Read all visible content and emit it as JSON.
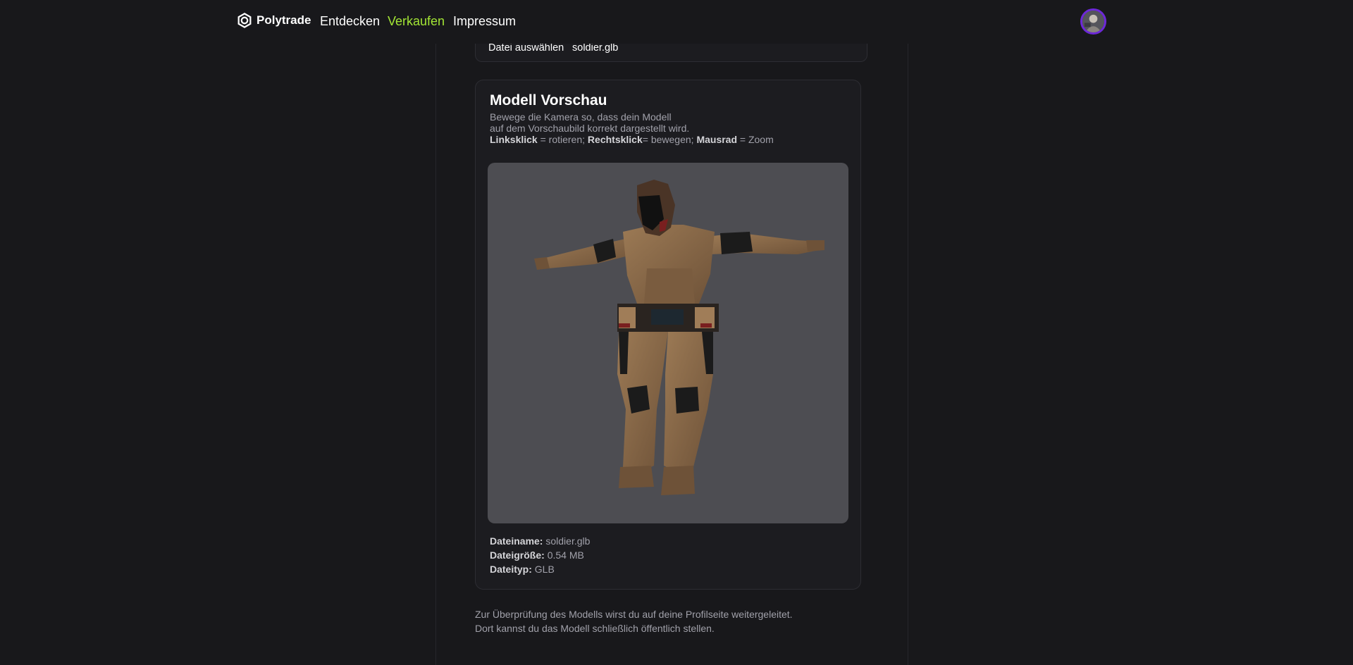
{
  "header": {
    "brand": "Polytrade",
    "nav": [
      {
        "label": "Entdecken"
      },
      {
        "label": "Verkaufen"
      },
      {
        "label": "Impressum"
      }
    ]
  },
  "upload": {
    "button_label": "Datei auswählen",
    "file_name": "soldier.glb"
  },
  "preview": {
    "title": "Modell Vorschau",
    "desc_line1": "Bewege die Kamera so, dass dein Modell",
    "desc_line2": "auf dem Vorschaubild korrekt dargestellt wird.",
    "controls": {
      "left_key": "Linksklick",
      "left_action": "= rotieren;",
      "right_key": "Rechtsklick",
      "right_action": "= bewegen;",
      "wheel_key": "Mausrad",
      "wheel_action": "= Zoom"
    },
    "meta": {
      "name_label": "Dateiname:",
      "name_value": "soldier.glb",
      "size_label": "Dateigröße:",
      "size_value": "0.54 MB",
      "type_label": "Dateityp:",
      "type_value": "GLB"
    }
  },
  "notice": {
    "line1": "Zur Überprüfung des Modells wirst du auf deine Profilseite weitergeleitet.",
    "line2": "Dort kannst du das Modell schließlich öffentlich stellen."
  },
  "colors": {
    "accent": "#a3e635",
    "avatar_ring": "#6d28d9",
    "background": "#18181b",
    "viewport": "#4d4d52"
  },
  "icons": {
    "logo": "polytrade-logo-icon",
    "avatar": "user-avatar"
  }
}
